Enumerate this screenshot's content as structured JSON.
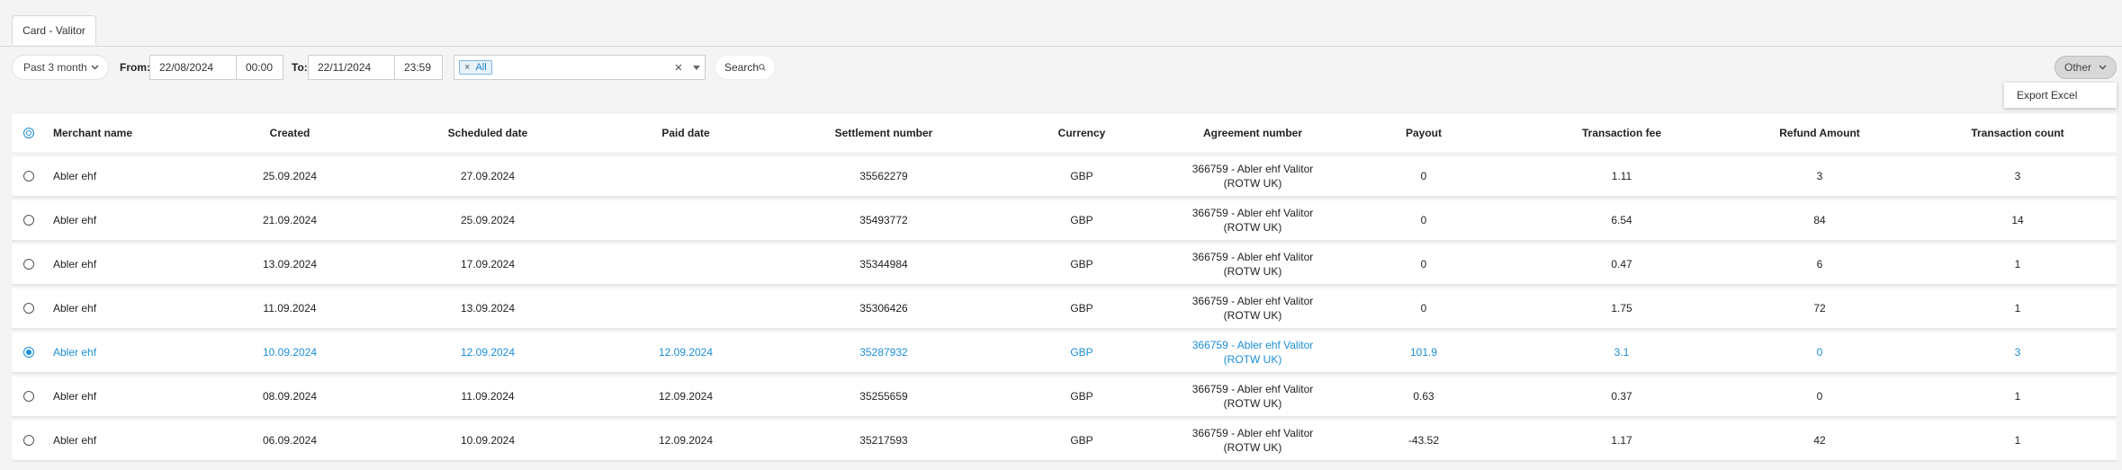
{
  "tab": {
    "label": "Card - Valitor"
  },
  "filters": {
    "period": "Past 3 month",
    "from_label": "From:",
    "from_date": "22/08/2024",
    "from_time": "00:00",
    "to_label": "To:",
    "to_date": "22/11/2024",
    "to_time": "23:59",
    "tag_x": "×",
    "tag": "All",
    "search": "Search"
  },
  "actions": {
    "other": "Other",
    "export": "Export Excel"
  },
  "columns": [
    "Merchant name",
    "Created",
    "Scheduled date",
    "Paid date",
    "Settlement number",
    "Currency",
    "Agreement number",
    "Payout",
    "Transaction fee",
    "Refund Amount",
    "Transaction count"
  ],
  "rows": [
    {
      "merchant": "Abler ehf",
      "created": "25.09.2024",
      "scheduled": "27.09.2024",
      "paid": "",
      "settlement": "35562279",
      "currency": "GBP",
      "agreement1": "366759 - Abler ehf Valitor",
      "agreement2": "(ROTW UK)",
      "payout": "0",
      "fee": "1.11",
      "refund": "3",
      "count": "3",
      "selected": false
    },
    {
      "merchant": "Abler ehf",
      "created": "21.09.2024",
      "scheduled": "25.09.2024",
      "paid": "",
      "settlement": "35493772",
      "currency": "GBP",
      "agreement1": "366759 - Abler ehf Valitor",
      "agreement2": "(ROTW UK)",
      "payout": "0",
      "fee": "6.54",
      "refund": "84",
      "count": "14",
      "selected": false
    },
    {
      "merchant": "Abler ehf",
      "created": "13.09.2024",
      "scheduled": "17.09.2024",
      "paid": "",
      "settlement": "35344984",
      "currency": "GBP",
      "agreement1": "366759 - Abler ehf Valitor",
      "agreement2": "(ROTW UK)",
      "payout": "0",
      "fee": "0.47",
      "refund": "6",
      "count": "1",
      "selected": false
    },
    {
      "merchant": "Abler ehf",
      "created": "11.09.2024",
      "scheduled": "13.09.2024",
      "paid": "",
      "settlement": "35306426",
      "currency": "GBP",
      "agreement1": "366759 - Abler ehf Valitor",
      "agreement2": "(ROTW UK)",
      "payout": "0",
      "fee": "1.75",
      "refund": "72",
      "count": "1",
      "selected": false
    },
    {
      "merchant": "Abler ehf",
      "created": "10.09.2024",
      "scheduled": "12.09.2024",
      "paid": "12.09.2024",
      "settlement": "35287932",
      "currency": "GBP",
      "agreement1": "366759 - Abler ehf Valitor",
      "agreement2": "(ROTW UK)",
      "payout": "101.9",
      "fee": "3.1",
      "refund": "0",
      "count": "3",
      "selected": true
    },
    {
      "merchant": "Abler ehf",
      "created": "08.09.2024",
      "scheduled": "11.09.2024",
      "paid": "12.09.2024",
      "settlement": "35255659",
      "currency": "GBP",
      "agreement1": "366759 - Abler ehf Valitor",
      "agreement2": "(ROTW UK)",
      "payout": "0.63",
      "fee": "0.37",
      "refund": "0",
      "count": "1",
      "selected": false
    },
    {
      "merchant": "Abler ehf",
      "created": "06.09.2024",
      "scheduled": "10.09.2024",
      "paid": "12.09.2024",
      "settlement": "35217593",
      "currency": "GBP",
      "agreement1": "366759 - Abler ehf Valitor",
      "agreement2": "(ROTW UK)",
      "payout": "-43.52",
      "fee": "1.17",
      "refund": "42",
      "count": "1",
      "selected": false
    }
  ],
  "colors": {
    "accent": "#1a8ed8",
    "background": "#f4f4f4"
  },
  "icons": [
    "chevron-down-icon",
    "clear-icon",
    "search-icon",
    "filter-icon",
    "radio-icon"
  ]
}
